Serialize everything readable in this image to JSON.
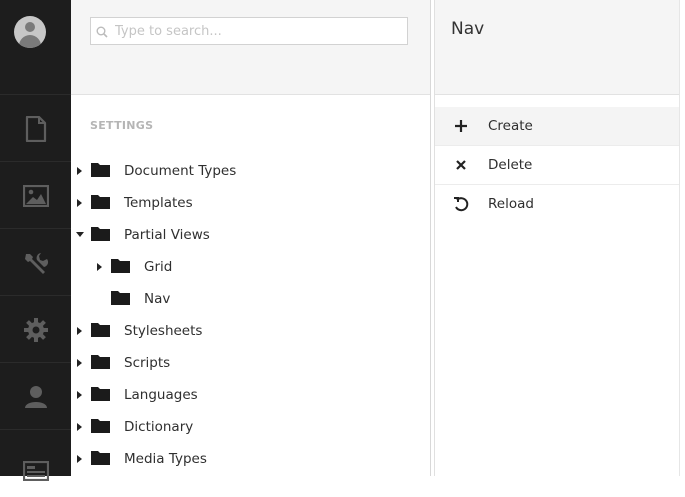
{
  "sidebar": {
    "sections": [
      {
        "name": "content",
        "icon": "document-icon"
      },
      {
        "name": "media",
        "icon": "image-icon"
      },
      {
        "name": "settings",
        "icon": "wrench-icon"
      },
      {
        "name": "developer",
        "icon": "gear-icon"
      },
      {
        "name": "users",
        "icon": "user-icon"
      },
      {
        "name": "members",
        "icon": "id-card-icon"
      }
    ]
  },
  "search": {
    "placeholder": "Type to search..."
  },
  "tree": {
    "section_title": "SETTINGS",
    "nodes": [
      {
        "label": "Document Types",
        "expanded": false,
        "has_children": true
      },
      {
        "label": "Templates",
        "expanded": false,
        "has_children": true
      },
      {
        "label": "Partial Views",
        "expanded": true,
        "has_children": true
      },
      {
        "label": "Grid",
        "expanded": false,
        "has_children": true
      },
      {
        "label": "Nav",
        "expanded": false,
        "has_children": false
      },
      {
        "label": "Stylesheets",
        "expanded": false,
        "has_children": true
      },
      {
        "label": "Scripts",
        "expanded": false,
        "has_children": true
      },
      {
        "label": "Languages",
        "expanded": false,
        "has_children": true
      },
      {
        "label": "Dictionary",
        "expanded": false,
        "has_children": true
      },
      {
        "label": "Media Types",
        "expanded": false,
        "has_children": true
      }
    ]
  },
  "actions_panel": {
    "title": "Nav",
    "items": [
      {
        "label": "Create",
        "icon": "plus-icon"
      },
      {
        "label": "Delete",
        "icon": "close-icon"
      },
      {
        "label": "Reload",
        "icon": "reload-icon"
      }
    ]
  },
  "colors": {
    "rail_bg": "#1d1d1d",
    "rail_icon": "#5e5e5e",
    "header_bg": "#f5f5f5",
    "section_title": "#b5b5b5"
  }
}
